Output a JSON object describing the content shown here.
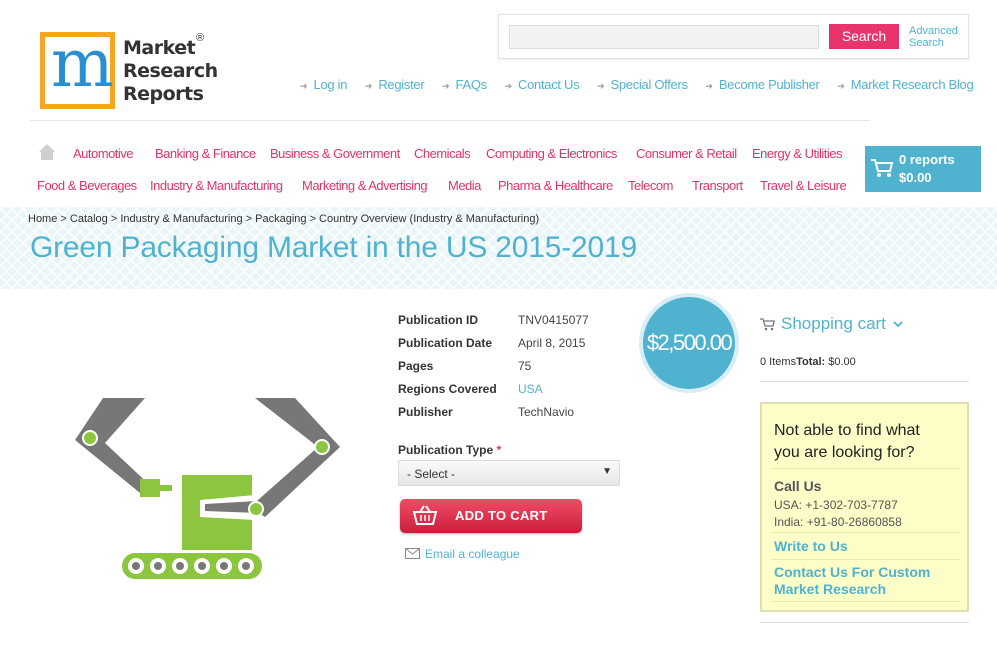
{
  "logo": {
    "line1": "Market",
    "line2": "Research",
    "line3": "Reports",
    "reg": "®",
    "letter": "m"
  },
  "search": {
    "button": "Search",
    "advanced_line1": "Advanced",
    "advanced_line2": "Search",
    "placeholder": ""
  },
  "toplinks": [
    "Log in",
    "Register",
    "FAQs",
    "Contact Us",
    "Special Offers",
    "Become Publisher",
    "Market Research Blog"
  ],
  "categories_row1": [
    "Automotive",
    "Banking & Finance",
    "Business & Government",
    "Chemicals",
    "Computing & Electronics",
    "Consumer & Retail",
    "Energy & Utilities"
  ],
  "categories_row2": [
    "Food & Beverages",
    "Industry & Manufacturing",
    "Marketing & Advertising",
    "Media",
    "Pharma & Healthcare",
    "Telecom",
    "Transport",
    "Travel & Leisure"
  ],
  "cart": {
    "count": "0 reports",
    "total": "$0.00"
  },
  "breadcrumb": "Home > Catalog > Industry & Manufacturing > Packaging > Country Overview (Industry & Manufacturing)",
  "title": "Green Packaging Market in the US 2015-2019",
  "details": [
    {
      "label": "Publication ID",
      "value": "TNV0415077"
    },
    {
      "label": "Publication Date",
      "value": "April 8, 2015"
    },
    {
      "label": "Pages",
      "value": "75"
    },
    {
      "label": "Regions Covered",
      "value": "USA"
    },
    {
      "label": "Publisher",
      "value": "TechNavio"
    }
  ],
  "price": "$2,500.00",
  "publication_type": {
    "label": "Publication Type",
    "required_mark": "*",
    "selected": "- Select -"
  },
  "add_to_cart": "ADD TO CART",
  "email_colleague": "Email a colleague",
  "sidebar": {
    "cart_title": "Shopping cart",
    "items_label": "0 Items",
    "total_label": "Total:",
    "total_value": "$0.00",
    "help_question_line1": "Not able to find what",
    "help_question_line2": "you are looking for?",
    "call_us": "Call Us",
    "usa_phone": "USA: +1-302-703-7787",
    "india_phone": "India: +91-80-26860858",
    "write_to_us": "Write to Us",
    "custom_line1": "Contact Us For Custom",
    "custom_line2": "Market Research"
  },
  "colors": {
    "accent": "#4fb3d0",
    "brand_pink": "#e0336a",
    "product_green": "#8cc63f",
    "arm_grey": "#666666"
  }
}
